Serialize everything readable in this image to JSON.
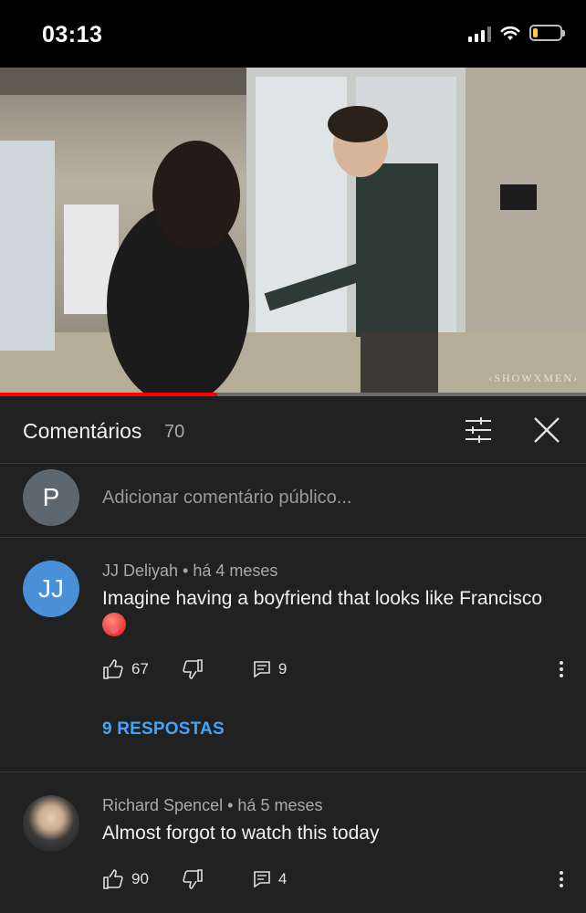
{
  "status_bar": {
    "time": "03:13"
  },
  "video": {
    "watermark": "‹SHOWXMEN›",
    "progress": 0.37
  },
  "comments_header": {
    "title": "Comentários",
    "count": "70"
  },
  "add_comment": {
    "avatar_letter": "P",
    "placeholder": "Adicionar comentário público..."
  },
  "comments": [
    {
      "avatar_letter": "JJ",
      "avatar_color": "#4a90d9",
      "author": "JJ Deliyah",
      "age": "há 4 meses",
      "text": "Imagine having a boyfriend that looks like Francisco",
      "emoji": "hot-face-emoji",
      "likes": "67",
      "replies_count": "9",
      "replies_label": "9 RESPOSTAS"
    },
    {
      "author": "Richard Spencel",
      "age": "há 5 meses",
      "text": "Almost forgot to watch this today",
      "likes": "90",
      "replies_count": "4"
    }
  ],
  "separator": "•",
  "colors": {
    "accent_link": "#3ea6ff",
    "progress": "#ff0000",
    "background": "#212121"
  }
}
